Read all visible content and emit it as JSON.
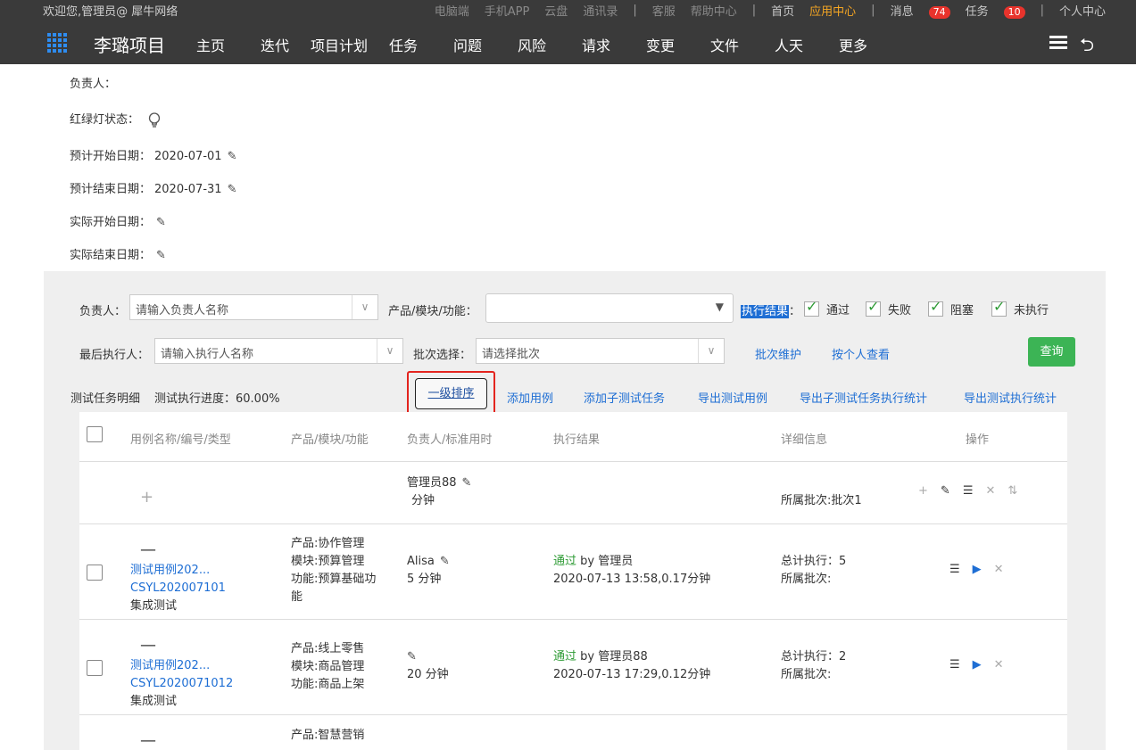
{
  "topbar": {
    "welcome": "欢迎您,管理员@ 犀牛网络",
    "links_muted": [
      "电脑端",
      "手机APP",
      "云盘",
      "通讯录"
    ],
    "links_help": [
      "客服",
      "帮助中心"
    ],
    "home": "首页",
    "app_center": "应用中心",
    "messages": "消息",
    "messages_count": "74",
    "tasks": "任务",
    "tasks_count": "10",
    "personal": "个人中心"
  },
  "nav": {
    "project_title": "李璐项目",
    "items": [
      "主页",
      "迭代",
      "项目计划",
      "任务",
      "问题",
      "风险",
      "请求",
      "变更",
      "文件",
      "人天",
      "更多"
    ]
  },
  "info": {
    "owner_label": "负责人：",
    "light_label": "红绿灯状态：",
    "plan_start_label": "预计开始日期：",
    "plan_start": "2020-07-01",
    "plan_end_label": "预计结束日期：",
    "plan_end": "2020-07-31",
    "actual_start_label": "实际开始日期：",
    "actual_end_label": "实际结束日期："
  },
  "filters": {
    "owner_label": "负责人：",
    "owner_placeholder": "请输入负责人名称",
    "product_label": "产品/模块/功能：",
    "result_label": "执行结果",
    "result_colon": "：",
    "results": [
      "通过",
      "失败",
      "阻塞",
      "未执行"
    ],
    "last_exec_label": "最后执行人：",
    "last_exec_placeholder": "请输入执行人名称",
    "batch_label": "批次选择：",
    "batch_placeholder": "请选择批次",
    "batch_maintain": "批次维护",
    "by_person": "按个人查看",
    "query": "查询"
  },
  "toolbar": {
    "title": "测试任务明细",
    "progress": "测试执行进度：60.00%",
    "sort": "一级排序",
    "add_case": "添加用例",
    "add_sub": "添加子测试任务",
    "export_cases": "导出测试用例",
    "export_sub_stats": "导出子测试任务执行统计",
    "export_exec_stats": "导出测试执行统计"
  },
  "table": {
    "headers": [
      "用例名称/编号/类型",
      "产品/模块/功能",
      "负责人/标准用时",
      "执行结果",
      "详细信息",
      "操作"
    ],
    "add_row": {
      "owner": "管理员88",
      "time": "分钟",
      "batch": "所属批次:批次1"
    },
    "rows": [
      {
        "name": "测试用例202...",
        "code": "CSYL202007101",
        "type": "集成测试",
        "product": "产品:协作管理",
        "module": "模块:预算管理",
        "function": "功能:预算基础功",
        "function2": "能",
        "owner": "Alisa",
        "time": "5 分钟",
        "result": "通过",
        "by": " by 管理员",
        "exec_time": "2020-07-13 13:58,0.17分钟",
        "total": "总计执行：5",
        "batch": "所属批次:"
      },
      {
        "name": "测试用例202...",
        "code": "CSYL2020071012",
        "type": "集成测试",
        "product": "产品:线上零售",
        "module": "模块:商品管理",
        "function": "功能:商品上架",
        "owner": "",
        "time": "20 分钟",
        "result": "通过",
        "by": " by 管理员88",
        "exec_time": "2020-07-13 17:29,0.12分钟",
        "total": "总计执行：2",
        "batch": "所属批次:"
      },
      {
        "product": "产品:智慧营销"
      }
    ]
  }
}
